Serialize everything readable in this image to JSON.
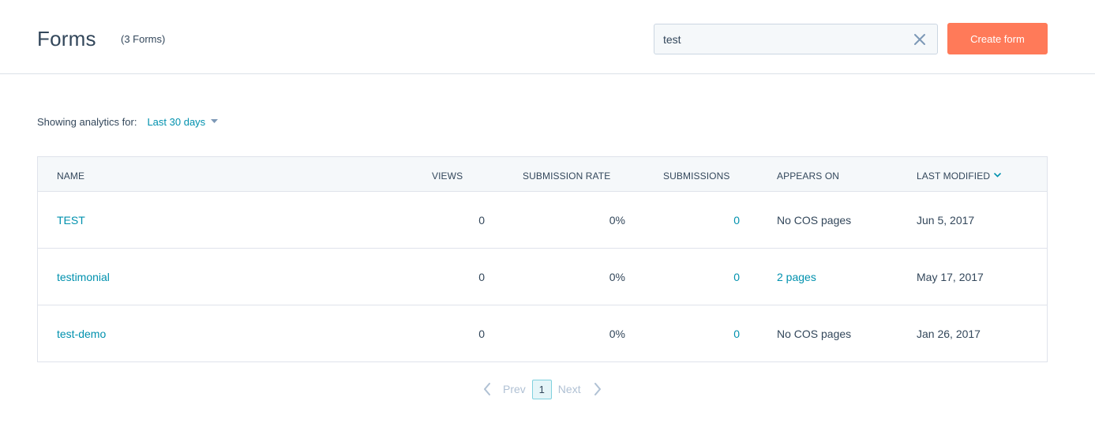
{
  "header": {
    "title": "Forms",
    "count": "(3 Forms)",
    "search_value": "test",
    "create_label": "Create form"
  },
  "analytics": {
    "label": "Showing analytics for:",
    "range": "Last 30 days"
  },
  "table": {
    "columns": {
      "name": "NAME",
      "views": "VIEWS",
      "submission_rate": "SUBMISSION RATE",
      "submissions": "SUBMISSIONS",
      "appears_on": "APPEARS ON",
      "last_modified": "LAST MODIFIED"
    },
    "rows": [
      {
        "name": "TEST",
        "views": "0",
        "rate": "0%",
        "submissions": "0",
        "appears_on": "No COS pages",
        "modified": "Jun 5, 2017"
      },
      {
        "name": "testimonial",
        "views": "0",
        "rate": "0%",
        "submissions": "0",
        "appears_on": "2 pages",
        "modified": "May 17, 2017"
      },
      {
        "name": "test-demo",
        "views": "0",
        "rate": "0%",
        "submissions": "0",
        "appears_on": "No COS pages",
        "modified": "Jan 26, 2017"
      }
    ]
  },
  "pagination": {
    "prev": "Prev",
    "current": "1",
    "next": "Next"
  },
  "colors": {
    "accent": "#0091ae",
    "primary_button": "#ff7a59",
    "text": "#33475b",
    "muted": "#b0c1d4"
  }
}
